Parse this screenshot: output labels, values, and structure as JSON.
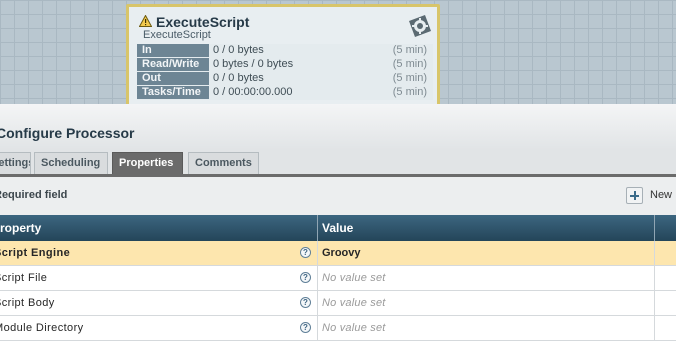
{
  "processor": {
    "name": "ExecuteScript",
    "type": "ExecuteScript",
    "stats": [
      {
        "label": "In",
        "value": "0 / 0 bytes",
        "window": "(5 min)"
      },
      {
        "label": "Read/Write",
        "value": "0 bytes / 0 bytes",
        "window": "(5 min)"
      },
      {
        "label": "Out",
        "value": "0 / 0 bytes",
        "window": "(5 min)"
      },
      {
        "label": "Tasks/Time",
        "value": "0 / 00:00:00.000",
        "window": "(5 min)"
      }
    ],
    "icons": {
      "warning": "warning-triangle-icon",
      "logo": "processor-gear-icon"
    }
  },
  "dialog": {
    "title": "Configure Processor",
    "tabs": [
      {
        "label": "Settings",
        "active": false
      },
      {
        "label": "Scheduling",
        "active": false
      },
      {
        "label": "Properties",
        "active": true
      },
      {
        "label": "Comments",
        "active": false
      }
    ],
    "required_text": "Required field",
    "new_button": "New",
    "table": {
      "headers": [
        "Property",
        "Value"
      ],
      "rows": [
        {
          "property": "Script Engine",
          "value": "Groovy",
          "selected": true,
          "empty": false
        },
        {
          "property": "Script File",
          "value": "No value set",
          "selected": false,
          "empty": true
        },
        {
          "property": "Script Body",
          "value": "No value set",
          "selected": false,
          "empty": true
        },
        {
          "property": "Module Directory",
          "value": "No value set",
          "selected": false,
          "empty": true
        }
      ]
    }
  },
  "colors": {
    "canvas": "#b9c7d0",
    "header_bar": "#244559",
    "selected_row": "#fde6ae",
    "active_tab": "#6b6b6b",
    "stat_label": "#6d8594"
  }
}
